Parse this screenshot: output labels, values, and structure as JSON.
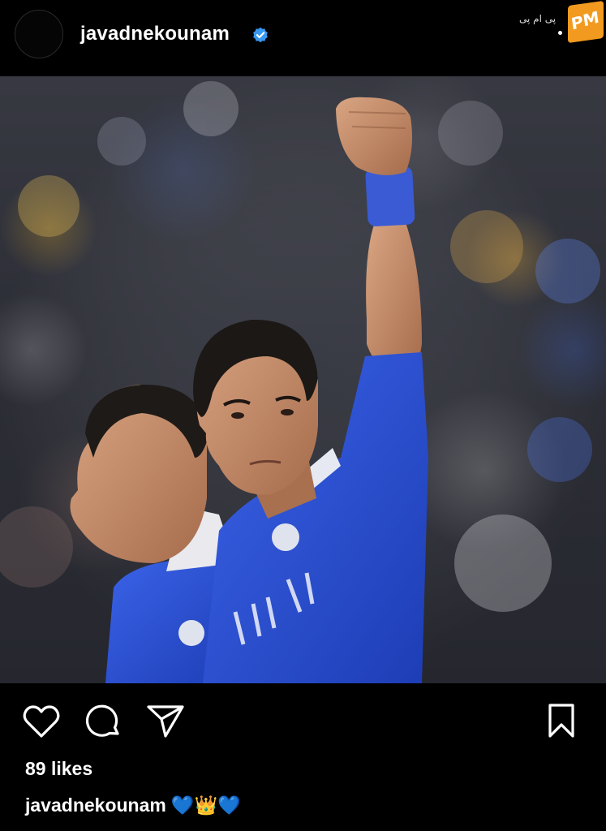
{
  "post": {
    "username": "javadnekounam",
    "verified": true,
    "likes_text": "89 likes",
    "caption_user": "javadnekounam",
    "caption_text": "💙👑💙",
    "image_description": "Two football players in blue jerseys; one raises a fist"
  },
  "icons": {
    "like": "heart-icon",
    "comment": "comment-icon",
    "share": "send-icon",
    "save": "bookmark-icon",
    "verified": "verified-badge-icon"
  },
  "watermark": {
    "text": "پی ام پی",
    "badge": "PM"
  },
  "colors": {
    "background": "#000000",
    "verified": "#3897f0",
    "jersey": "#2a4fd6",
    "watermark": "#f29a1f"
  }
}
